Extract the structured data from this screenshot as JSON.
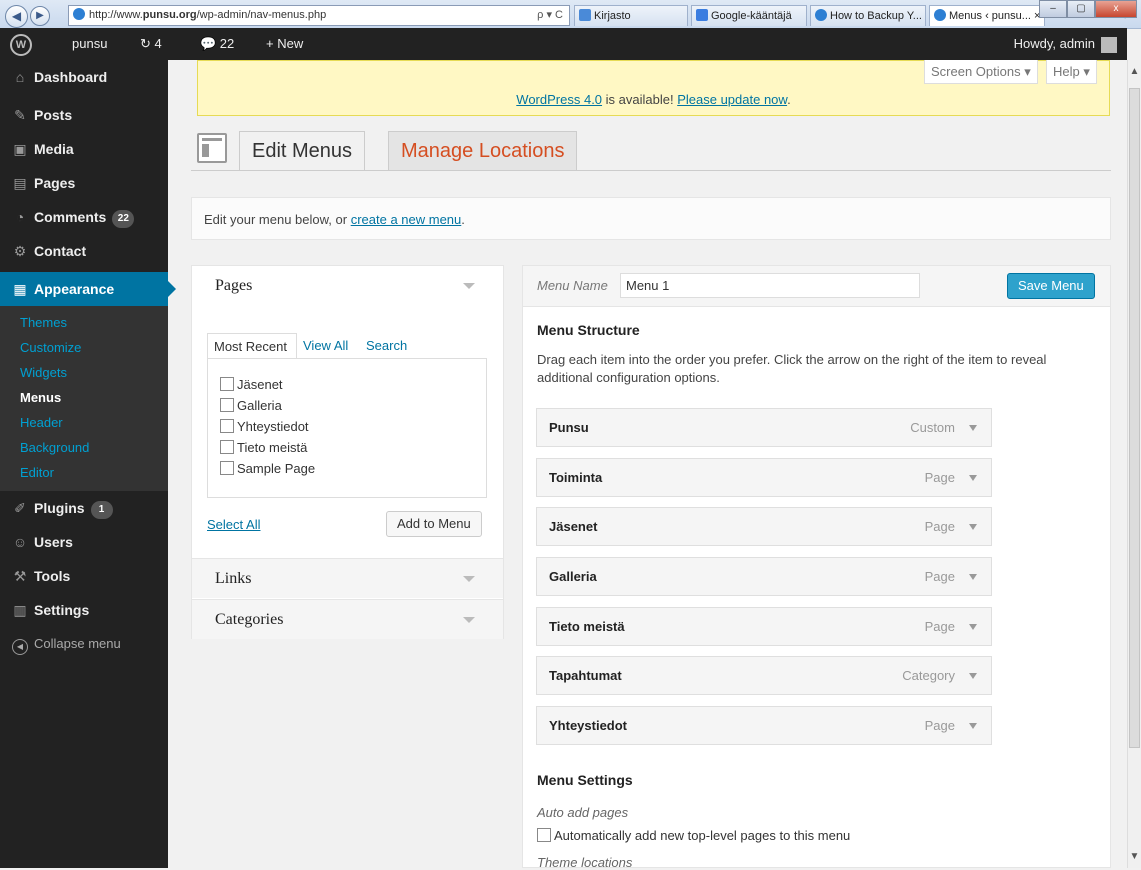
{
  "browser": {
    "url_prefix": "http://www.",
    "url_domain": "punsu.org",
    "url_path": "/wp-admin/nav-menus.php",
    "url_controls": "ρ ▾ C",
    "tabs": [
      {
        "label": "Kirjasto"
      },
      {
        "label": "Google-kääntäjä"
      },
      {
        "label": "How to Backup Y..."
      },
      {
        "label": "Menus ‹ punsu... ×"
      }
    ],
    "right_icons": "⌂☆⚙",
    "min": "–",
    "max": "▢",
    "close": "x"
  },
  "adminbar": {
    "logo": "W",
    "site": "punsu",
    "updates": "↻ 4",
    "comments": "💬 22",
    "new": "+ New",
    "howdy": "Howdy, admin"
  },
  "sidebar": {
    "dashboard": "Dashboard",
    "posts": "Posts",
    "media": "Media",
    "pages": "Pages",
    "comments": "Comments",
    "comments_count": "22",
    "contact": "Contact",
    "appearance": "Appearance",
    "sub": [
      "Themes",
      "Customize",
      "Widgets",
      "Menus",
      "Header",
      "Background",
      "Editor"
    ],
    "plugins": "Plugins",
    "plugins_count": "1",
    "users": "Users",
    "tools": "Tools",
    "settings": "Settings",
    "collapse": "Collapse menu"
  },
  "nag": {
    "version_link": "WordPress 4.0",
    "middle": " is available! ",
    "update_link": "Please update now",
    "end": ".",
    "screen_options": "Screen Options ▾",
    "help": "Help ▾"
  },
  "tabs": {
    "edit": "Edit Menus",
    "manage": "Manage Locations"
  },
  "info": {
    "text": "Edit your menu below, or ",
    "link": "create a new menu",
    "end": "."
  },
  "accordion": {
    "pages_title": "Pages",
    "inner_tabs": [
      "Most Recent",
      "View All",
      "Search"
    ],
    "items": [
      "Jäsenet",
      "Galleria",
      "Yhteystiedot",
      "Tieto meistä",
      "Sample Page"
    ],
    "select_all": "Select All",
    "add_to_menu": "Add to Menu",
    "links_title": "Links",
    "categories_title": "Categories"
  },
  "editor": {
    "menu_name_label": "Menu Name",
    "menu_name_value": "Menu 1",
    "save": "Save Menu",
    "structure_title": "Menu Structure",
    "structure_desc": "Drag each item into the order you prefer. Click the arrow on the right of the item to reveal additional configuration options.",
    "items": [
      {
        "title": "Punsu",
        "type": "Custom"
      },
      {
        "title": "Toiminta",
        "type": "Page"
      },
      {
        "title": "Jäsenet",
        "type": "Page"
      },
      {
        "title": "Galleria",
        "type": "Page"
      },
      {
        "title": "Tieto meistä",
        "type": "Page"
      },
      {
        "title": "Tapahtumat",
        "type": "Category"
      },
      {
        "title": "Yhteystiedot",
        "type": "Page"
      }
    ],
    "settings_title": "Menu Settings",
    "auto_add_label": "Auto add pages",
    "auto_add_check": "Automatically add new top-level pages to this menu",
    "theme_locations": "Theme locations"
  }
}
